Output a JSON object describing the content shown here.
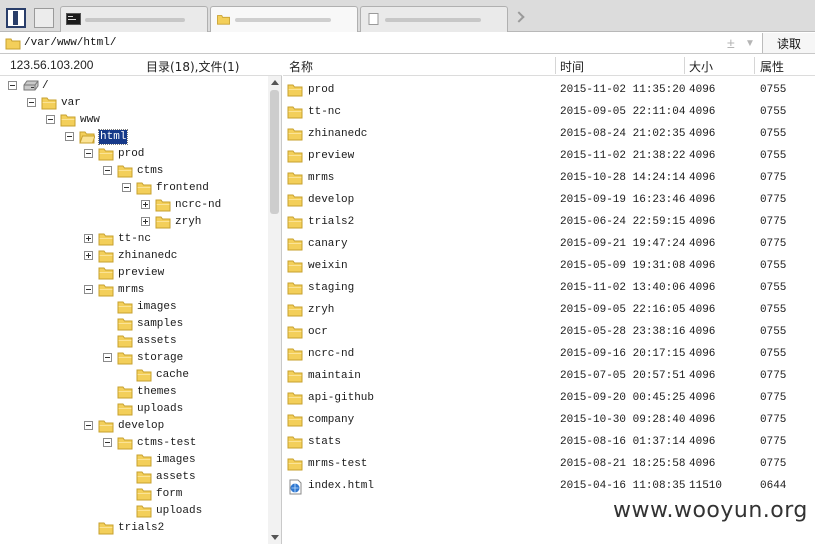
{
  "address": {
    "path": "/var/www/html/",
    "plus": "±",
    "dropdown": "▼",
    "read_label": "读取"
  },
  "left_panel": {
    "ip": "123.56.103.200",
    "count": "目录(18),文件(1)",
    "tree": [
      {
        "label": "/",
        "depth": 0,
        "expander": "minus",
        "icon": "drive-icon"
      },
      {
        "label": "var",
        "depth": 1,
        "expander": "minus",
        "icon": "folder-icon"
      },
      {
        "label": "www",
        "depth": 2,
        "expander": "minus",
        "icon": "folder-icon"
      },
      {
        "label": "html",
        "depth": 3,
        "expander": "minus",
        "icon": "folder-open-icon",
        "selected": true
      },
      {
        "label": "prod",
        "depth": 4,
        "expander": "minus",
        "icon": "folder-icon"
      },
      {
        "label": "ctms",
        "depth": 5,
        "expander": "minus",
        "icon": "folder-icon"
      },
      {
        "label": "frontend",
        "depth": 6,
        "expander": "minus",
        "icon": "folder-icon"
      },
      {
        "label": "ncrc-nd",
        "depth": 7,
        "expander": "plus",
        "icon": "folder-icon"
      },
      {
        "label": "zryh",
        "depth": 7,
        "expander": "plus",
        "icon": "folder-icon"
      },
      {
        "label": "tt-nc",
        "depth": 4,
        "expander": "plus",
        "icon": "folder-icon"
      },
      {
        "label": "zhinanedc",
        "depth": 4,
        "expander": "plus",
        "icon": "folder-icon"
      },
      {
        "label": "preview",
        "depth": 4,
        "expander": "none",
        "icon": "folder-icon"
      },
      {
        "label": "mrms",
        "depth": 4,
        "expander": "minus",
        "icon": "folder-icon"
      },
      {
        "label": "images",
        "depth": 5,
        "expander": "none",
        "icon": "folder-icon"
      },
      {
        "label": "samples",
        "depth": 5,
        "expander": "none",
        "icon": "folder-icon"
      },
      {
        "label": "assets",
        "depth": 5,
        "expander": "none",
        "icon": "folder-icon"
      },
      {
        "label": "storage",
        "depth": 5,
        "expander": "minus",
        "icon": "folder-icon"
      },
      {
        "label": "cache",
        "depth": 6,
        "expander": "none",
        "icon": "folder-icon"
      },
      {
        "label": "themes",
        "depth": 5,
        "expander": "none",
        "icon": "folder-icon"
      },
      {
        "label": "uploads",
        "depth": 5,
        "expander": "none",
        "icon": "folder-icon"
      },
      {
        "label": "develop",
        "depth": 4,
        "expander": "minus",
        "icon": "folder-icon"
      },
      {
        "label": "ctms-test",
        "depth": 5,
        "expander": "minus",
        "icon": "folder-icon"
      },
      {
        "label": "images",
        "depth": 6,
        "expander": "none",
        "icon": "folder-icon"
      },
      {
        "label": "assets",
        "depth": 6,
        "expander": "none",
        "icon": "folder-icon"
      },
      {
        "label": "form",
        "depth": 6,
        "expander": "none",
        "icon": "folder-icon"
      },
      {
        "label": "uploads",
        "depth": 6,
        "expander": "none",
        "icon": "folder-icon"
      },
      {
        "label": "trials2",
        "depth": 4,
        "expander": "none",
        "icon": "folder-icon"
      }
    ]
  },
  "file_list": {
    "columns": {
      "name": "名称",
      "time": "时间",
      "size": "大小",
      "attr": "属性"
    },
    "rows": [
      {
        "name": "prod",
        "time": "2015-11-02 11:35:20",
        "size": "4096",
        "attr": "0755",
        "icon": "folder-icon"
      },
      {
        "name": "tt-nc",
        "time": "2015-09-05 22:11:04",
        "size": "4096",
        "attr": "0755",
        "icon": "folder-icon"
      },
      {
        "name": "zhinanedc",
        "time": "2015-08-24 21:02:35",
        "size": "4096",
        "attr": "0755",
        "icon": "folder-icon"
      },
      {
        "name": "preview",
        "time": "2015-11-02 21:38:22",
        "size": "4096",
        "attr": "0755",
        "icon": "folder-icon"
      },
      {
        "name": "mrms",
        "time": "2015-10-28 14:24:14",
        "size": "4096",
        "attr": "0775",
        "icon": "folder-icon"
      },
      {
        "name": "develop",
        "time": "2015-09-19 16:23:46",
        "size": "4096",
        "attr": "0775",
        "icon": "folder-icon"
      },
      {
        "name": "trials2",
        "time": "2015-06-24 22:59:15",
        "size": "4096",
        "attr": "0775",
        "icon": "folder-icon"
      },
      {
        "name": "canary",
        "time": "2015-09-21 19:47:24",
        "size": "4096",
        "attr": "0775",
        "icon": "folder-icon"
      },
      {
        "name": "weixin",
        "time": "2015-05-09 19:31:08",
        "size": "4096",
        "attr": "0755",
        "icon": "folder-icon"
      },
      {
        "name": "staging",
        "time": "2015-11-02 13:40:06",
        "size": "4096",
        "attr": "0755",
        "icon": "folder-icon"
      },
      {
        "name": "zryh",
        "time": "2015-09-05 22:16:05",
        "size": "4096",
        "attr": "0755",
        "icon": "folder-icon"
      },
      {
        "name": "ocr",
        "time": "2015-05-28 23:38:16",
        "size": "4096",
        "attr": "0755",
        "icon": "folder-icon"
      },
      {
        "name": "ncrc-nd",
        "time": "2015-09-16 20:17:15",
        "size": "4096",
        "attr": "0755",
        "icon": "folder-icon"
      },
      {
        "name": "maintain",
        "time": "2015-07-05 20:57:51",
        "size": "4096",
        "attr": "0775",
        "icon": "folder-icon"
      },
      {
        "name": "api-github",
        "time": "2015-09-20 00:45:25",
        "size": "4096",
        "attr": "0775",
        "icon": "folder-icon"
      },
      {
        "name": "company",
        "time": "2015-10-30 09:28:40",
        "size": "4096",
        "attr": "0775",
        "icon": "folder-icon"
      },
      {
        "name": "stats",
        "time": "2015-08-16 01:37:14",
        "size": "4096",
        "attr": "0775",
        "icon": "folder-icon"
      },
      {
        "name": "mrms-test",
        "time": "2015-08-21 18:25:58",
        "size": "4096",
        "attr": "0775",
        "icon": "folder-icon"
      },
      {
        "name": "index.html",
        "time": "2015-04-16 11:08:35",
        "size": "11510",
        "attr": "0644",
        "icon": "html-file-icon"
      }
    ]
  },
  "watermark": "www.wooyun.org",
  "colors": {
    "folder": "#f3cf5a",
    "folder_edge": "#c7a02e",
    "selection": "#173a8a"
  }
}
